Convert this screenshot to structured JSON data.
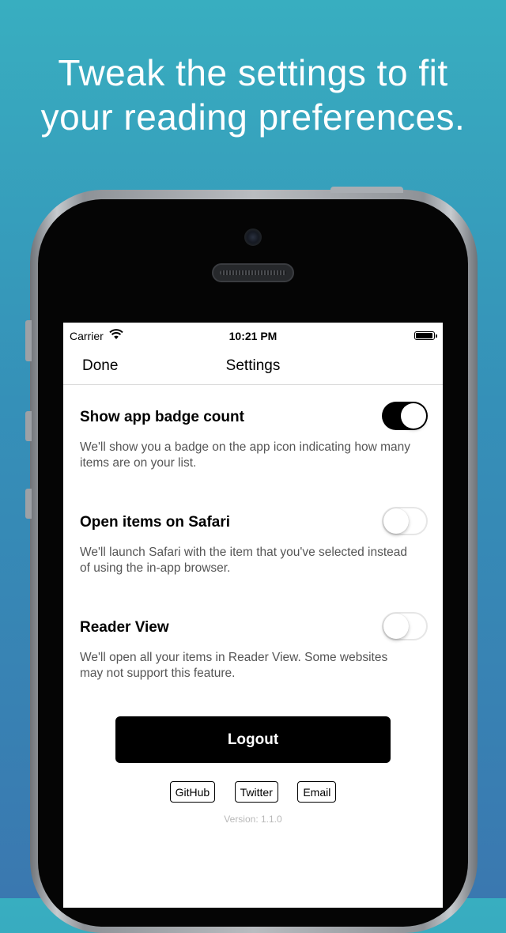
{
  "headline": {
    "line1": "Tweak the settings to fit",
    "line2": "your reading preferences."
  },
  "statusbar": {
    "carrier": "Carrier",
    "time": "10:21 PM",
    "wifi_icon": "wifi-icon",
    "battery_icon": "battery-icon"
  },
  "navbar": {
    "done_label": "Done",
    "title": "Settings"
  },
  "settings": [
    {
      "title": "Show app badge count",
      "description": "We'll show you a badge on the app icon indicating how many items are on your list.",
      "enabled": true
    },
    {
      "title": "Open items on Safari",
      "description": "We'll launch Safari with the item that you've selected instead of using the in-app browser.",
      "enabled": false
    },
    {
      "title": "Reader View",
      "description": "We'll open all your items in Reader View. Some websites may not support this feature.",
      "enabled": false
    }
  ],
  "logout_label": "Logout",
  "links": {
    "github": "GitHub",
    "twitter": "Twitter",
    "email": "Email"
  },
  "version": "Version: 1.1.0",
  "colors": {
    "background_top": "#38aec0",
    "background_bottom": "#3a78b0",
    "toggle_on": "#000000",
    "button": "#000000"
  }
}
